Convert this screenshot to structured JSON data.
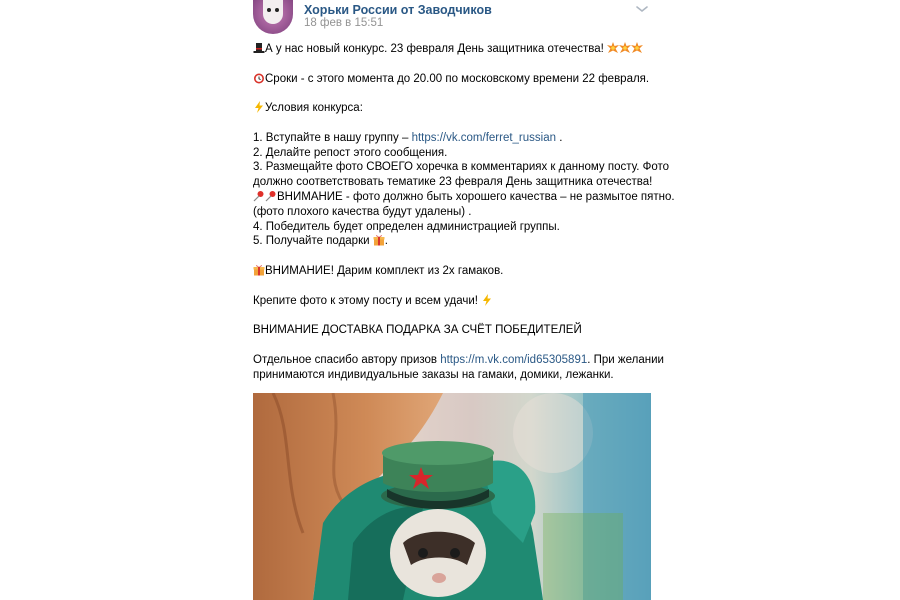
{
  "group": {
    "name": "Хорьки России от Заводчиков",
    "date": "18 фев в 15:51"
  },
  "post": {
    "l1": "А у нас новый конкурс. 23 февраля День защитника отечества!",
    "l2": "Сроки - с этого момента до 20.00 по московскому времени 22 февраля.",
    "l3": "Условия конкурса:",
    "l4_pre": "1. Вступайте в нашу группу – ",
    "l4_link": "https://vk.com/ferret_russian",
    "l4_post": " .",
    "l5": "2. Делайте репост этого сообщения.",
    "l6": "3. Размещайте фото СВОЕГО хоречка в комментариях к данному посту. Фото",
    "l7": "должно соответствовать тематике 23 февраля День защитника отечества!",
    "l8": "ВНИМАНИЕ - фото должно быть хорошего качества – не размытое пятно.",
    "l9": "(фото плохого качества будут удалены) .",
    "l10": "4. Победитель будет определен администрацией группы.",
    "l11": "5. Получайте подарки",
    "l11_post": ".",
    "l12": "ВНИМАНИЕ! Дарим комплект из 2х гамаков.",
    "l13": "Крепите фото к этому посту и всем удачи!",
    "l14": "ВНИМАНИЕ ДОСТАВКА ПОДАРКА ЗА СЧЁТ ПОБЕДИТЕЛЕЙ",
    "l15_pre": "Отдельное спасибо автору призов ",
    "l15_link": "https://m.vk.com/id65305891",
    "l15_post": ". При желании",
    "l16": "принимаются индивидуальные заказы на гамаки, домики, лежанки."
  },
  "colors": {
    "link": "#2a5885",
    "meta": "#939393"
  },
  "icons": [
    "top-hat-icon",
    "burst-icon",
    "alarm-icon",
    "lightning-icon",
    "pushpin-icon",
    "gift-icon",
    "chevron-down-icon"
  ]
}
